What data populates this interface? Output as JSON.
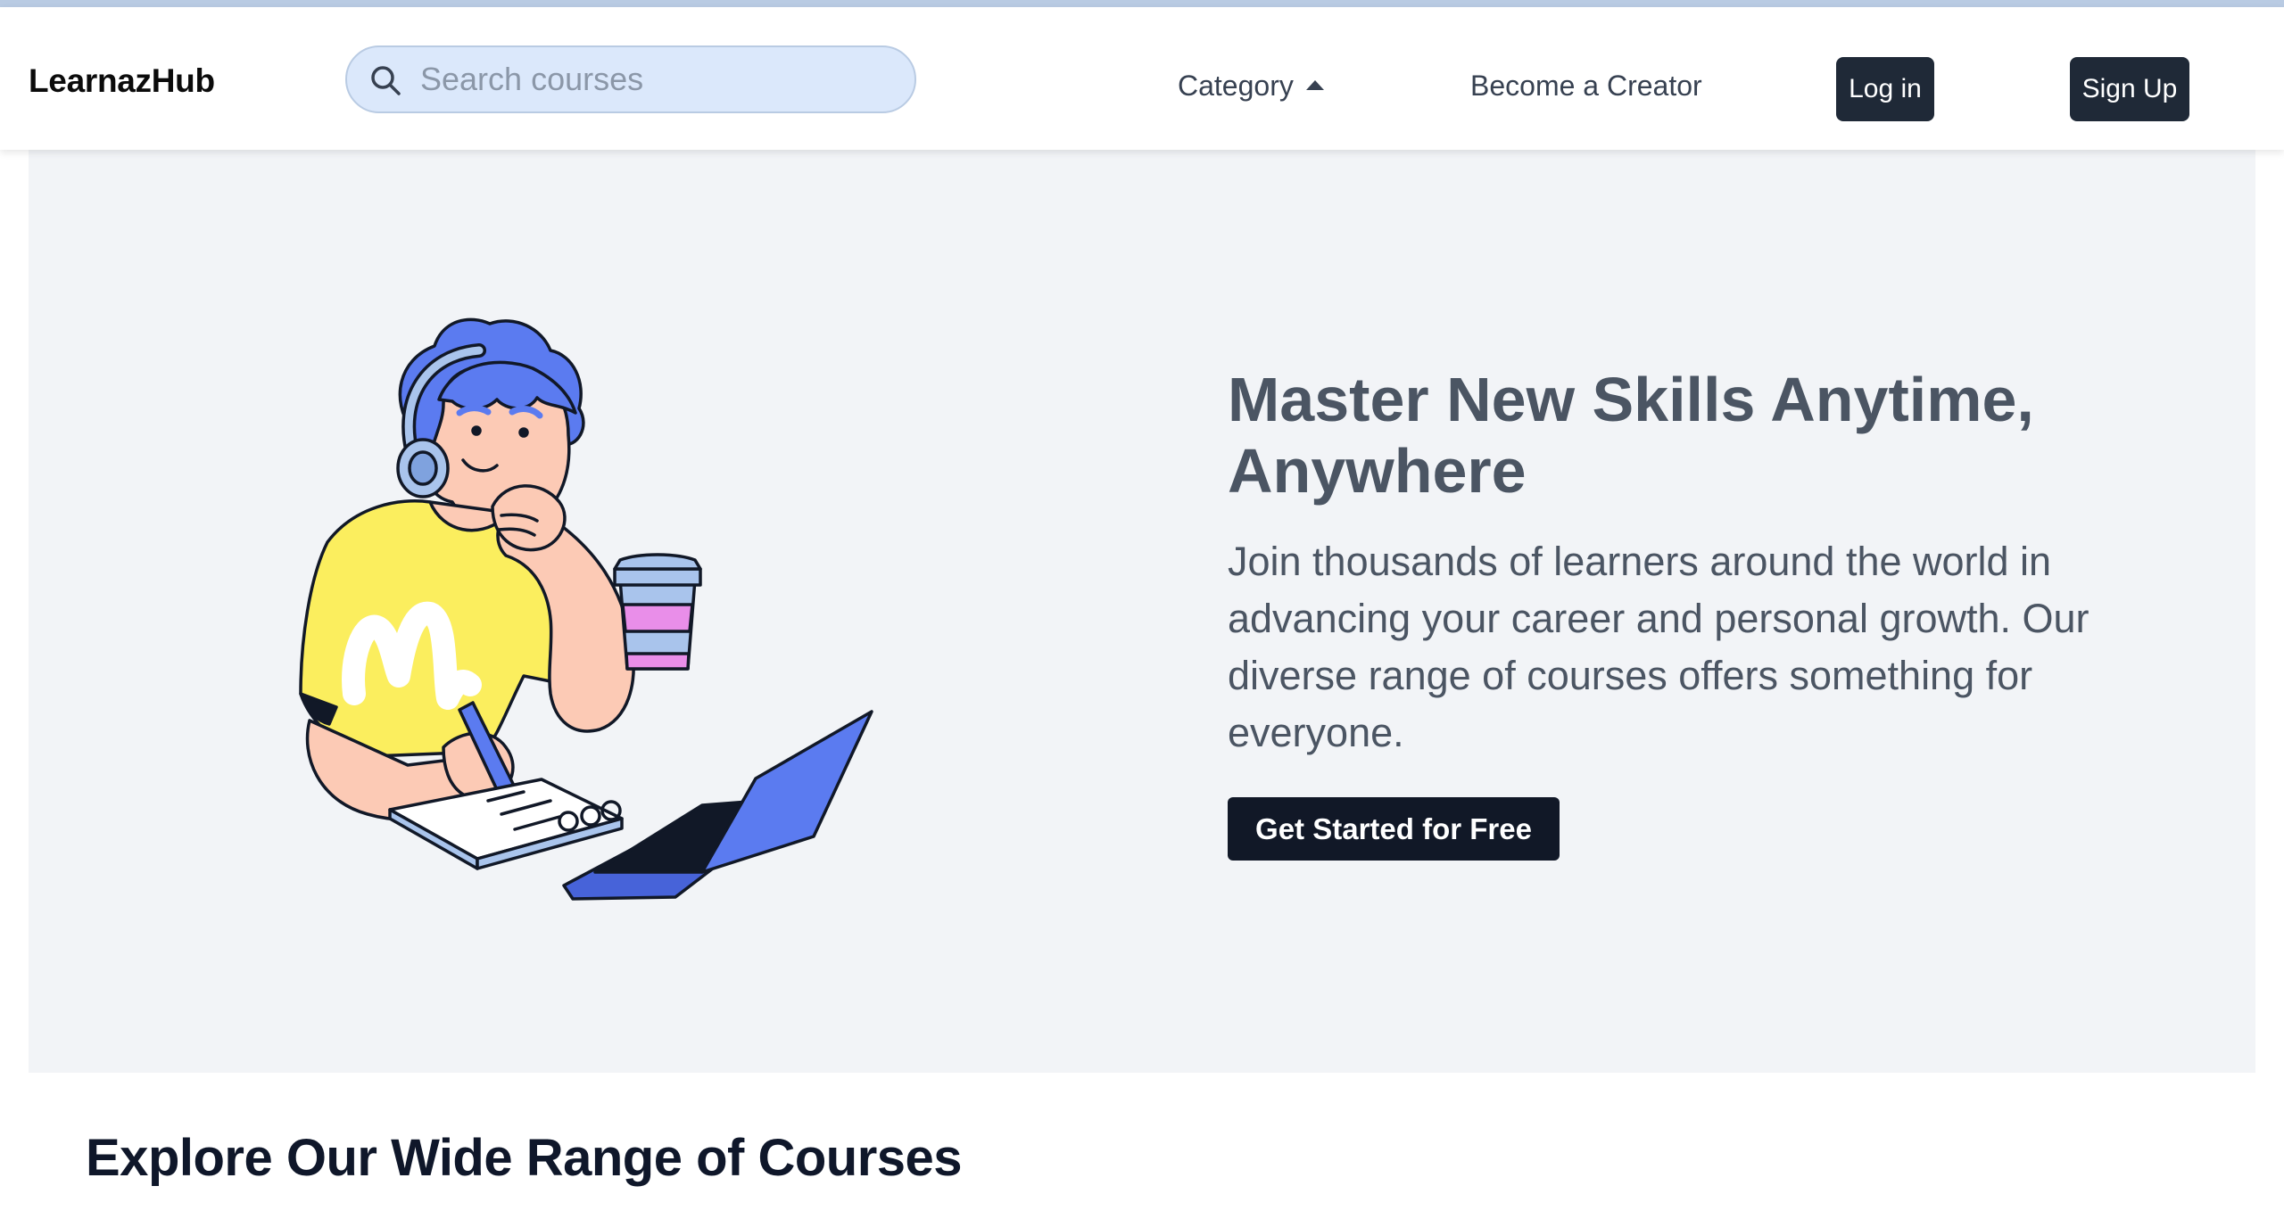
{
  "brand": {
    "name": "LearnazHub"
  },
  "search": {
    "placeholder": "Search courses",
    "icon": "search-icon"
  },
  "nav": {
    "category_label": "Category",
    "category_icon": "caret-up-icon",
    "creator_label": "Become a Creator",
    "login_label": "Log in",
    "signup_label": "Sign Up"
  },
  "hero": {
    "title": "Master New Skills Anytime, Anywhere",
    "description": "Join thousands of learners around the world in advancing your career and personal growth. Our diverse range of courses offers something for everyone.",
    "cta_label": "Get Started for Free",
    "illustration": "student-studying-illustration"
  },
  "courses": {
    "title": "Explore Our Wide Range of Courses"
  },
  "colors": {
    "primary_dark": "#1f2937",
    "hero_bg": "#f2f4f7",
    "search_bg": "#dbe8fb",
    "accent_blue": "#5b7bf0",
    "accent_yellow": "#fbee5e",
    "skin": "#fccab5"
  }
}
